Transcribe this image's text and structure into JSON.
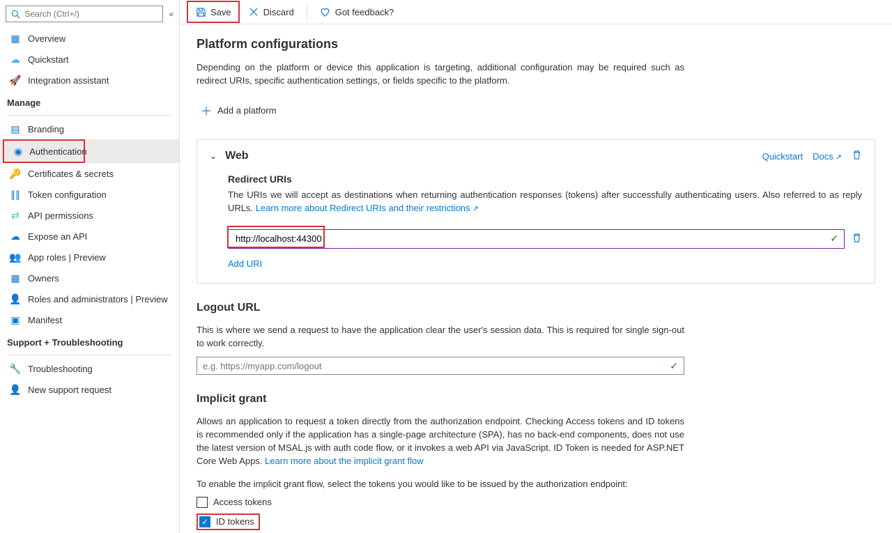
{
  "sidebar": {
    "search_placeholder": "Search (Ctrl+/)",
    "top_items": [
      {
        "icon": "overview",
        "label": "Overview",
        "color": "#0078d4"
      },
      {
        "icon": "quickstart",
        "label": "Quickstart",
        "color": "#50b0e8"
      },
      {
        "icon": "rocket",
        "label": "Integration assistant",
        "color": "#ff8c00"
      }
    ],
    "manage_label": "Manage",
    "manage_items": [
      {
        "icon": "branding",
        "label": "Branding",
        "color": "#0078d4"
      },
      {
        "icon": "auth",
        "label": "Authentication",
        "color": "#0078d4",
        "active": true,
        "highlight": true
      },
      {
        "icon": "key",
        "label": "Certificates & secrets",
        "color": "#ffb900"
      },
      {
        "icon": "token",
        "label": "Token configuration",
        "color": "#0078d4"
      },
      {
        "icon": "api",
        "label": "API permissions",
        "color": "#40c8ae"
      },
      {
        "icon": "cloud",
        "label": "Expose an API",
        "color": "#0078d4"
      },
      {
        "icon": "roles",
        "label": "App roles | Preview",
        "color": "#0078d4"
      },
      {
        "icon": "owners",
        "label": "Owners",
        "color": "#0078d4"
      },
      {
        "icon": "admins",
        "label": "Roles and administrators | Preview",
        "color": "#0078d4"
      },
      {
        "icon": "manifest",
        "label": "Manifest",
        "color": "#0078d4"
      }
    ],
    "support_label": "Support + Troubleshooting",
    "support_items": [
      {
        "icon": "wrench",
        "label": "Troubleshooting",
        "color": "#605e5c"
      },
      {
        "icon": "support",
        "label": "New support request",
        "color": "#0078d4"
      }
    ]
  },
  "toolbar": {
    "save": "Save",
    "discard": "Discard",
    "feedback": "Got feedback?"
  },
  "platform": {
    "title": "Platform configurations",
    "desc": "Depending on the platform or device this application is targeting, additional configuration may be required such as redirect URIs, specific authentication settings, or fields specific to the platform.",
    "add": "Add a platform"
  },
  "web": {
    "title": "Web",
    "quickstart": "Quickstart",
    "docs": "Docs",
    "redirect_title": "Redirect URIs",
    "redirect_desc": "The URIs we will accept as destinations when returning authentication responses (tokens) after successfully authenticating users. Also referred to as reply URLs. ",
    "learn": "Learn more about Redirect URIs and their restrictions",
    "uri_value": "http://localhost:44300",
    "add_uri": "Add URI"
  },
  "logout": {
    "title": "Logout URL",
    "desc": "This is where we send a request to have the application clear the user's session data. This is required for single sign-out to work correctly.",
    "placeholder": "e.g. https://myapp.com/logout"
  },
  "implicit": {
    "title": "Implicit grant",
    "desc": "Allows an application to request a token directly from the authorization endpoint. Checking Access tokens and ID tokens is recommended only if the application has a single-page architecture (SPA), has no back-end components, does not use the latest version of MSAL.js with auth code flow, or it invokes a web API via JavaScript. ID Token is needed for ASP.NET Core Web Apps. ",
    "learn": "Learn more about the implicit grant flow",
    "enable_desc": "To enable the implicit grant flow, select the tokens you would like to be issued by the authorization endpoint:",
    "access": "Access tokens",
    "id": "ID tokens"
  }
}
